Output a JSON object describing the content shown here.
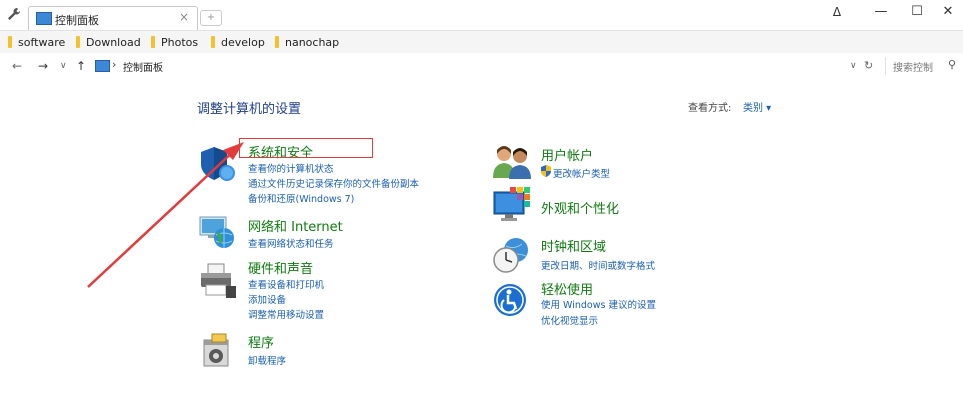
{
  "window": {
    "tab_title": "控制面板",
    "tab_close": "×",
    "new_tab": "+",
    "minimize": "—",
    "maximize": "☐",
    "close": "✕",
    "user_icon": "Δ"
  },
  "bookmarks": [
    {
      "label": "software"
    },
    {
      "label": "Download"
    },
    {
      "label": "Photos"
    },
    {
      "label": "develop"
    },
    {
      "label": "nanochap"
    }
  ],
  "address": {
    "back": "←",
    "forward": "→",
    "recent": "∨",
    "up": "↑",
    "separator": "›",
    "path": "控制面板",
    "dropdown": "∨",
    "refresh": "↻",
    "search_placeholder": "搜索控制",
    "search_glyph": "⚲"
  },
  "main": {
    "heading": "调整计算机的设置",
    "view_by_label": "查看方式:",
    "view_by_value": "类别 ▾"
  },
  "categories": {
    "system_security": {
      "title": "系统和安全",
      "links": [
        "查看你的计算机状态",
        "通过文件历史记录保存你的文件备份副本",
        "备份和还原(Windows 7)"
      ]
    },
    "network": {
      "title": "网络和 Internet",
      "links": [
        "查看网络状态和任务"
      ]
    },
    "hardware": {
      "title": "硬件和声音",
      "links": [
        "查看设备和打印机",
        "添加设备",
        "调整常用移动设置"
      ]
    },
    "programs": {
      "title": "程序",
      "links": [
        "卸载程序"
      ]
    },
    "user_accounts": {
      "title": "用户帐户",
      "links": [
        "更改帐户类型"
      ]
    },
    "appearance": {
      "title": "外观和个性化",
      "links": []
    },
    "clock_region": {
      "title": "时钟和区域",
      "links": [
        "更改日期、时间或数字格式"
      ]
    },
    "ease_of_access": {
      "title": "轻松使用",
      "links": [
        "使用 Windows 建议的设置",
        "优化视觉显示"
      ]
    }
  },
  "colors": {
    "category_title": "#0f7b0f",
    "link": "#1a5fb4",
    "heading": "#1e3f8a",
    "annotation": "#e23b3b"
  }
}
